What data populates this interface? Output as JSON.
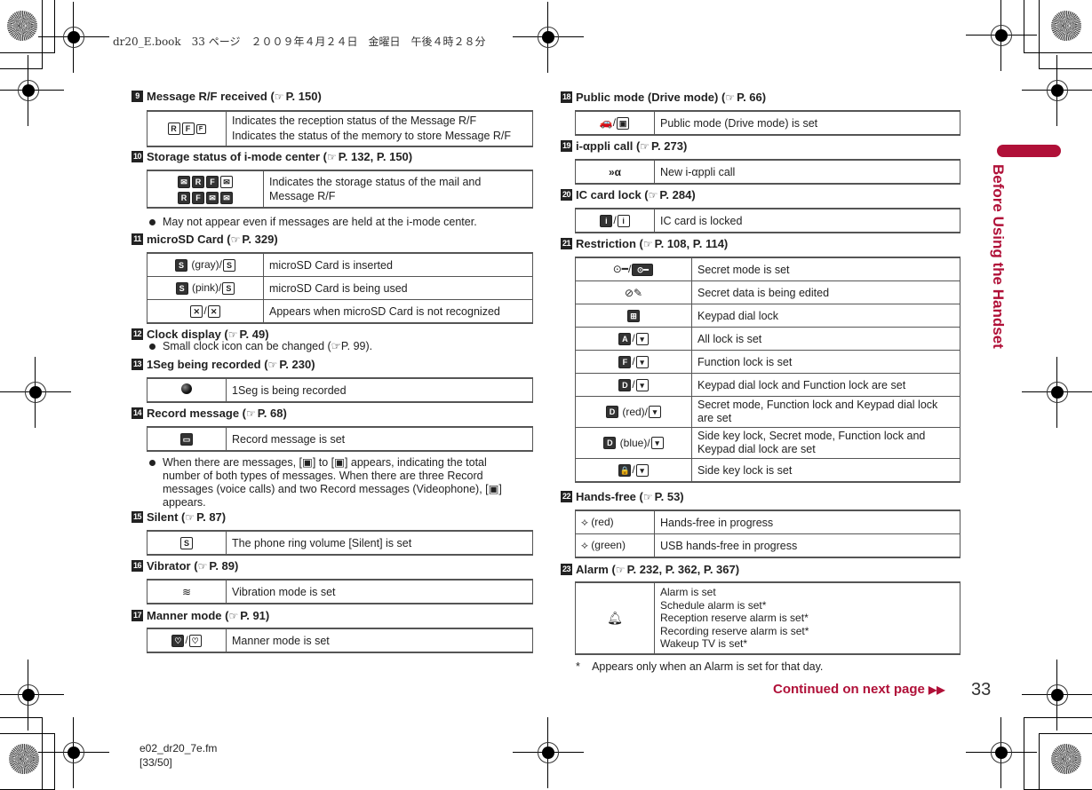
{
  "header": {
    "print_line": "dr20_E.book　33 ページ　２００９年４月２４日　金曜日　午後４時２８分"
  },
  "footer": {
    "file": "e02_dr20_7e.fm",
    "pages": "[33/50]"
  },
  "side_tab": {
    "label": "Before Using the Handset",
    "color": "#b01038"
  },
  "continued": {
    "label": "Continued on next page",
    "icon": "double-arrow-right"
  },
  "page_number": "33",
  "ref_icon": "☞",
  "sections": [
    {
      "num": "9",
      "title": "Message R/F received (",
      "ref": "P. 150)",
      "rows": [
        {
          "icons": "R F RF",
          "desc": [
            "Indicates the reception status of the Message R/F",
            "Indicates the status of the memory to store Message R/F"
          ]
        }
      ]
    },
    {
      "num": "10",
      "title": "Storage status of i-mode center (",
      "ref": "P. 132, P. 150)",
      "rows": [
        {
          "icons": "mail-folder icons",
          "desc": [
            "Indicates the storage status of the mail and",
            "Message R/F"
          ]
        }
      ],
      "note": "May not appear even if messages are held at the i-mode center."
    },
    {
      "num": "11",
      "title": "microSD Card (",
      "ref": "P. 329)",
      "rows": [
        {
          "icons": "(gray)/",
          "desc": [
            "microSD Card is inserted"
          ]
        },
        {
          "icons": "(pink)/",
          "desc": [
            "microSD Card is being used"
          ]
        },
        {
          "icons": "/",
          "desc": [
            "Appears when microSD Card is not recognized"
          ]
        }
      ]
    },
    {
      "num": "12",
      "title": "Clock display (",
      "ref": "P. 49)",
      "note": "Small clock icon can be changed (☞P. 99)."
    },
    {
      "num": "13",
      "title": "1Seg being recorded (",
      "ref": "P. 230)",
      "rows": [
        {
          "icons": "",
          "desc": [
            "1Seg is being recorded"
          ]
        }
      ]
    },
    {
      "num": "14",
      "title": "Record message (",
      "ref": "P. 68)",
      "rows": [
        {
          "icons": "",
          "desc": [
            "Record message is set"
          ]
        }
      ],
      "note_lines": [
        "When there are messages, [▣] to [▣] appears, indicating the total",
        "number of both types of messages. When there are three Record",
        "messages (voice calls) and two Record messages (Videophone), [▣]",
        "appears."
      ]
    },
    {
      "num": "15",
      "title": "Silent (",
      "ref": "P. 87)",
      "rows": [
        {
          "icons": "",
          "desc": [
            "The phone ring volume [Silent] is set"
          ]
        }
      ]
    },
    {
      "num": "16",
      "title": "Vibrator (",
      "ref": "P. 89)",
      "rows": [
        {
          "icons": "",
          "desc": [
            "Vibration mode is set"
          ]
        }
      ]
    },
    {
      "num": "17",
      "title": "Manner mode (",
      "ref": "P. 91)",
      "rows": [
        {
          "icons": "/",
          "desc": [
            "Manner mode is set"
          ]
        }
      ]
    },
    {
      "num": "18",
      "title": "Public mode (Drive mode) (",
      "ref": "P. 66)",
      "rows": [
        {
          "icons": "/",
          "desc": [
            "Public mode (Drive mode) is set"
          ]
        }
      ]
    },
    {
      "num": "19",
      "title": "i-αppli call (",
      "ref": "P. 273)",
      "rows": [
        {
          "icons": "",
          "desc": [
            "New i-αppli call"
          ]
        }
      ]
    },
    {
      "num": "20",
      "title": "IC card lock (",
      "ref": "P. 284)",
      "rows": [
        {
          "icons": "/",
          "desc": [
            "IC card is locked"
          ]
        }
      ]
    },
    {
      "num": "21",
      "title": "Restriction (",
      "ref": "P. 108, P. 114)",
      "rows": [
        {
          "icons": "/",
          "desc": [
            "Secret mode is set"
          ]
        },
        {
          "icons": "",
          "desc": [
            "Secret data is being edited"
          ]
        },
        {
          "icons": "",
          "desc": [
            "Keypad dial lock"
          ]
        },
        {
          "icons": "/",
          "desc": [
            "All lock is set"
          ]
        },
        {
          "icons": "/",
          "desc": [
            "Function lock is set"
          ]
        },
        {
          "icons": "/",
          "desc": [
            "Keypad dial lock and Function lock are set"
          ]
        },
        {
          "icons": "(red)/",
          "desc": [
            "Secret mode, Function lock and Keypad dial lock",
            "are set"
          ]
        },
        {
          "icons": "(blue)/",
          "desc": [
            "Side key lock, Secret mode, Function lock and",
            "Keypad dial lock are set"
          ]
        },
        {
          "icons": "/",
          "desc": [
            "Side key lock is set"
          ]
        }
      ]
    },
    {
      "num": "22",
      "title": "Hands-free (",
      "ref": "P. 53)",
      "rows": [
        {
          "icons": "(red)",
          "desc": [
            "Hands-free in progress"
          ]
        },
        {
          "icons": "(green)",
          "desc": [
            "USB hands-free in progress"
          ]
        }
      ]
    },
    {
      "num": "23",
      "title": "Alarm (",
      "ref": "P. 232, P. 362, P. 367)",
      "rows": [
        {
          "icons": "",
          "desc": [
            "Alarm is set",
            "Schedule alarm is set*",
            "Reception reserve alarm is set*",
            "Recording reserve alarm is set*",
            "Wakeup TV is set*"
          ]
        }
      ],
      "footnote": "*    Appears only when an Alarm is set for that day."
    }
  ]
}
